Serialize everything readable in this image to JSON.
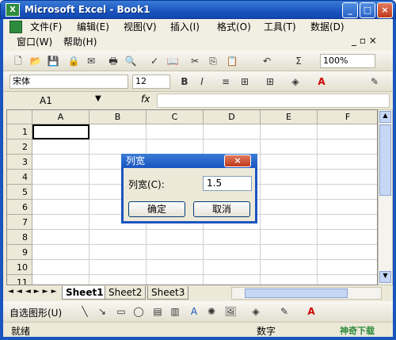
{
  "window": {
    "title": "Microsoft Excel - Book1",
    "app_icon": "X"
  },
  "menu": {
    "row1": [
      "文件(F)",
      "编辑(E)",
      "视图(V)",
      "插入(I)",
      "格式(O)",
      "工具(T)",
      "数据(D)"
    ],
    "row2": [
      "窗口(W)",
      "帮助(H)"
    ]
  },
  "formatting": {
    "font": "宋体",
    "size": "12",
    "zoom": "100%"
  },
  "formula": {
    "namebox": "A1",
    "fx": "fx"
  },
  "columns": [
    "A",
    "B",
    "C",
    "D",
    "E",
    "F"
  ],
  "rows": [
    "1",
    "2",
    "3",
    "4",
    "5",
    "6",
    "7",
    "8",
    "9",
    "10",
    "11"
  ],
  "sheets": [
    "Sheet1",
    "Sheet2",
    "Sheet3"
  ],
  "draw": {
    "autoshape": "自选图形(U)"
  },
  "status": {
    "left": "就绪",
    "mid": "数字",
    "watermark": "神奇下载"
  },
  "dialog": {
    "title": "列宽",
    "label": "列宽(C):",
    "value": "1.5",
    "ok": "确定",
    "cancel": "取消"
  }
}
